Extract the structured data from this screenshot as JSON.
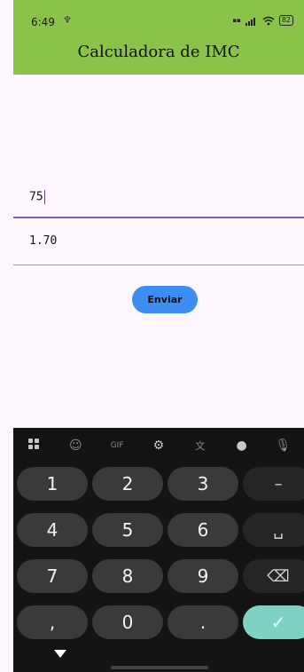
{
  "status_bar": {
    "time": "6:49",
    "left_icon": "notification-icon",
    "right_icons": [
      "data-speed-icon",
      "signal-icon",
      "wifi-icon",
      "battery-icon"
    ],
    "battery_level": "82"
  },
  "app": {
    "title": "Calculadora de IMC",
    "accent_color": "#8bc34a",
    "weight_value": "75",
    "height_value": "1.70",
    "send_label": "Enviar",
    "button_color": "#3d8ef2"
  },
  "keyboard": {
    "toolbar": [
      "apps-icon",
      "sticker-icon",
      "gif-icon",
      "settings-icon",
      "translate-icon",
      "palette-icon",
      "mic-icon"
    ],
    "gif_label": "GIF",
    "keys": {
      "k1": "1",
      "k2": "2",
      "k3": "3",
      "minus": "–",
      "k4": "4",
      "k5": "5",
      "k6": "6",
      "space": "␣",
      "k7": "7",
      "k8": "8",
      "k9": "9",
      "backspace": "⌫",
      "comma": ",",
      "k0": "0",
      "period": ".",
      "done": "✓"
    },
    "done_color": "#7fd1c3"
  }
}
